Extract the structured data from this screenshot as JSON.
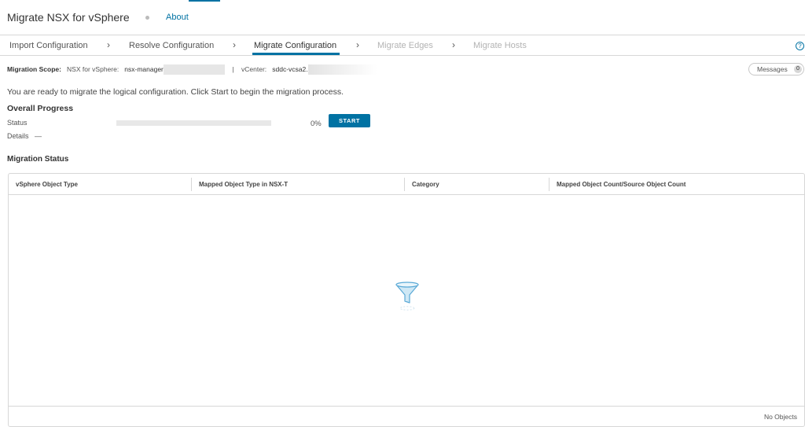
{
  "header": {
    "title": "Migrate NSX for vSphere",
    "about": "About"
  },
  "steps": [
    {
      "label": "Import Configuration",
      "state": "done"
    },
    {
      "label": "Resolve Configuration",
      "state": "done"
    },
    {
      "label": "Migrate Configuration",
      "state": "active"
    },
    {
      "label": "Migrate Edges",
      "state": "disabled"
    },
    {
      "label": "Migrate Hosts",
      "state": "disabled"
    }
  ],
  "scope": {
    "label": "Migration Scope:",
    "nsx_label": "NSX for vSphere:",
    "nsx_value": "nsx-manager",
    "separator": "|",
    "vcenter_label": "vCenter:",
    "vcenter_value": "sddc-vcsa2."
  },
  "messages": {
    "label": "Messages",
    "count": "0"
  },
  "ready_text": "You are ready to migrate the logical configuration. Click Start to begin the migration process.",
  "progress": {
    "title": "Overall Progress",
    "status_label": "Status",
    "percent_text": "0%",
    "value": 0,
    "start_label": "START",
    "details_label": "Details",
    "details_value": "—"
  },
  "migration_status": {
    "title": "Migration Status",
    "columns": [
      "vSphere Object Type",
      "Mapped Object Type in NSX-T",
      "Category",
      "Mapped Object Count/Source Object Count"
    ],
    "rows": [],
    "footer": "No Objects"
  },
  "colors": {
    "accent": "#0072a3"
  }
}
